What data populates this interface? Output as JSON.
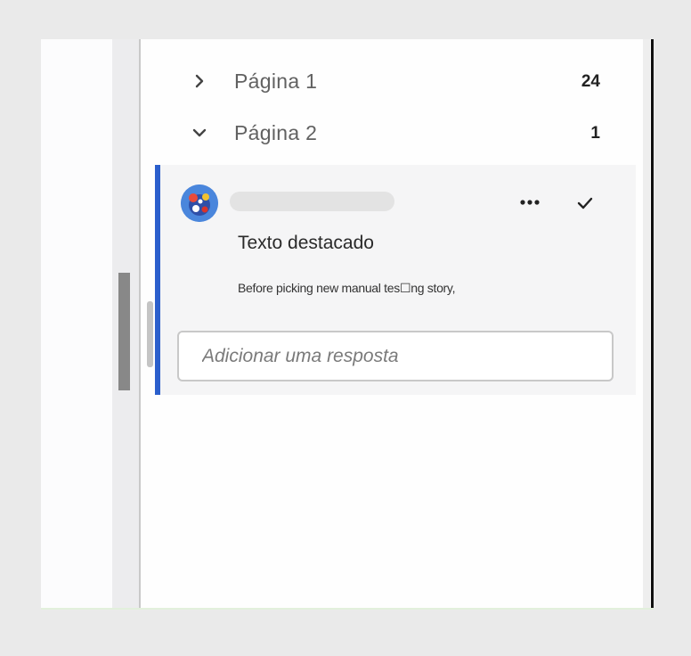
{
  "pages": [
    {
      "label": "Página 1",
      "count": "24",
      "expanded": false,
      "chevron_icon": "chevron-right-icon"
    },
    {
      "label": "Página 2",
      "count": "1",
      "expanded": true,
      "chevron_icon": "chevron-down-icon"
    }
  ],
  "comment": {
    "title": "Texto destacado",
    "excerpt": "Before picking new manual tes☐ng story,",
    "accent_color": "#2b5fcc",
    "more_icon": "more-horizontal-icon",
    "resolve_icon": "checkmark-icon"
  },
  "reply": {
    "placeholder": "Adicionar uma resposta",
    "value": ""
  }
}
